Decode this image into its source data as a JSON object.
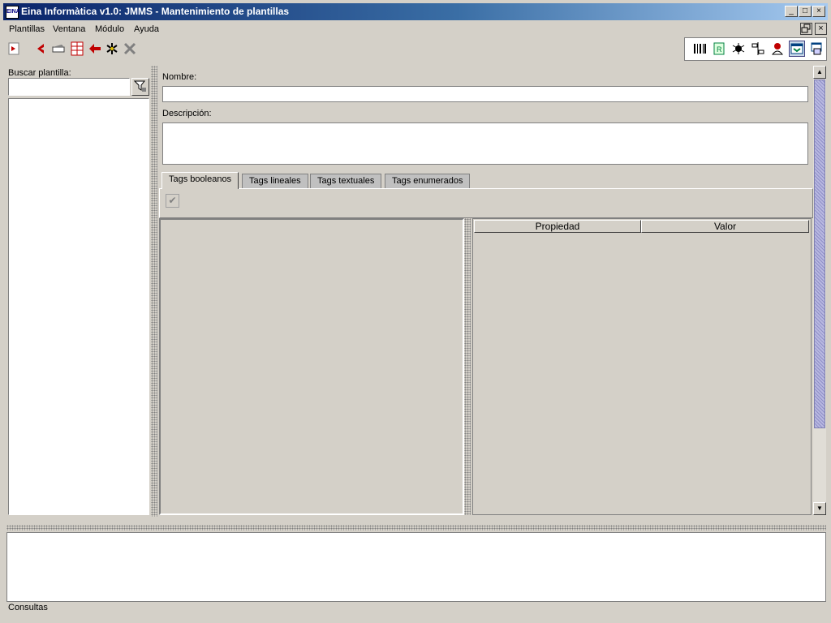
{
  "window": {
    "logo_text": "EINA",
    "title": "Eina Informàtica v1.0: JMMS - Mantenimiento de plantillas",
    "minimize": "_",
    "maximize": "□",
    "close": "×"
  },
  "menu": {
    "items": [
      "Plantillas",
      "Ventana",
      "Módulo",
      "Ayuda"
    ]
  },
  "toolbar": {
    "left_icons": [
      "login-icon",
      "back-icon",
      "forward-icon",
      "grid-icon",
      "refresh-icon",
      "asterisk-icon",
      "delete-icon"
    ],
    "right_icons": [
      "barcode-icon",
      "report-icon",
      "bug-icon",
      "split-icon",
      "user-icon",
      "layout-icon",
      "window-icon"
    ]
  },
  "left_panel": {
    "search_label": "Buscar plantilla:",
    "search_value": "",
    "filter_icon": "filter-icon"
  },
  "form": {
    "nombre_label": "Nombre:",
    "nombre_value": "",
    "descripcion_label": "Descripción:",
    "descripcion_value": ""
  },
  "tabs": [
    "Tags booleanos",
    "Tags lineales",
    "Tags textuales",
    "Tags enumerados"
  ],
  "active_tab": "Tags booleanos",
  "properties_table": {
    "columns": [
      "Propiedad",
      "Valor"
    ],
    "rows": []
  },
  "status": {
    "text": "Consultas"
  },
  "colors": {
    "titlebar_start": "#0a246a",
    "titlebar_end": "#a6caf0",
    "face": "#d4d0c8"
  }
}
